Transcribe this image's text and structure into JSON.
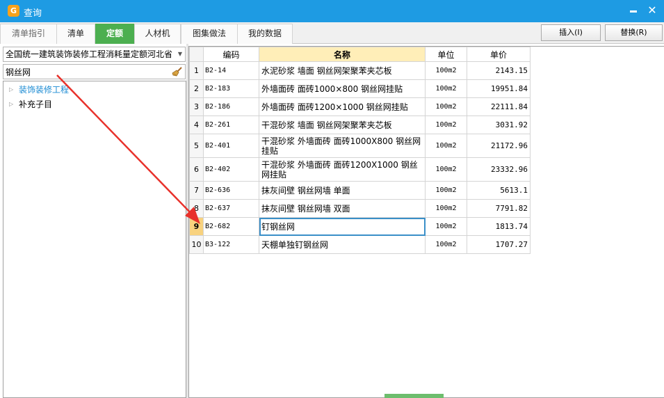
{
  "window": {
    "title": "查询",
    "app_icon_letter": "G"
  },
  "tabs": [
    {
      "label": "清单指引"
    },
    {
      "label": "清单"
    },
    {
      "label": "定额"
    },
    {
      "label": "人材机"
    },
    {
      "label": "图集做法"
    },
    {
      "label": "我的数据"
    }
  ],
  "actions": {
    "insert": "插入(I)",
    "replace": "替换(R)"
  },
  "left": {
    "library_select": "全国统一建筑装饰装修工程消耗量定额河北省",
    "search_value": "钢丝网",
    "tree": [
      {
        "label": "装饰装修工程"
      },
      {
        "label": "补充子目"
      }
    ]
  },
  "table": {
    "headers": {
      "code": "编码",
      "name": "名称",
      "unit": "单位",
      "price": "单价"
    },
    "rows": [
      {
        "no": "1",
        "code": "B2-14",
        "name": "水泥砂浆 墙面 钢丝网架聚苯夹芯板",
        "unit": "100m2",
        "price": "2143.15"
      },
      {
        "no": "2",
        "code": "B2-183",
        "name": "外墙面砖 面砖1000×800 钢丝网挂贴",
        "unit": "100m2",
        "price": "19951.84"
      },
      {
        "no": "3",
        "code": "B2-186",
        "name": "外墙面砖 面砖1200×1000 钢丝网挂贴",
        "unit": "100m2",
        "price": "22111.84"
      },
      {
        "no": "4",
        "code": "B2-261",
        "name": "干混砂浆 墙面 钢丝网架聚苯夹芯板",
        "unit": "100m2",
        "price": "3031.92"
      },
      {
        "no": "5",
        "code": "B2-401",
        "name": "干混砂浆 外墙面砖 面砖1000X800 钢丝网挂贴",
        "unit": "100m2",
        "price": "21172.96"
      },
      {
        "no": "6",
        "code": "B2-402",
        "name": "干混砂浆 外墙面砖 面砖1200X1000 钢丝网挂贴",
        "unit": "100m2",
        "price": "23332.96"
      },
      {
        "no": "7",
        "code": "B2-636",
        "name": "抹灰间壁 钢丝网墙 单面",
        "unit": "100m2",
        "price": "5613.1"
      },
      {
        "no": "8",
        "code": "B2-637",
        "name": "抹灰间壁 钢丝网墙 双面",
        "unit": "100m2",
        "price": "7791.82"
      },
      {
        "no": "9",
        "code": "B2-682",
        "name": "钉钢丝网",
        "unit": "100m2",
        "price": "1813.74"
      },
      {
        "no": "10",
        "code": "B3-122",
        "name": "天棚单独钉钢丝网",
        "unit": "100m2",
        "price": "1707.27"
      }
    ],
    "selected_row": "9"
  },
  "colors": {
    "titlebar": "#1e9be3",
    "active_tab": "#4caf50",
    "annotation_arrow": "#e8312b",
    "selection_outline": "#3a8fc8"
  }
}
